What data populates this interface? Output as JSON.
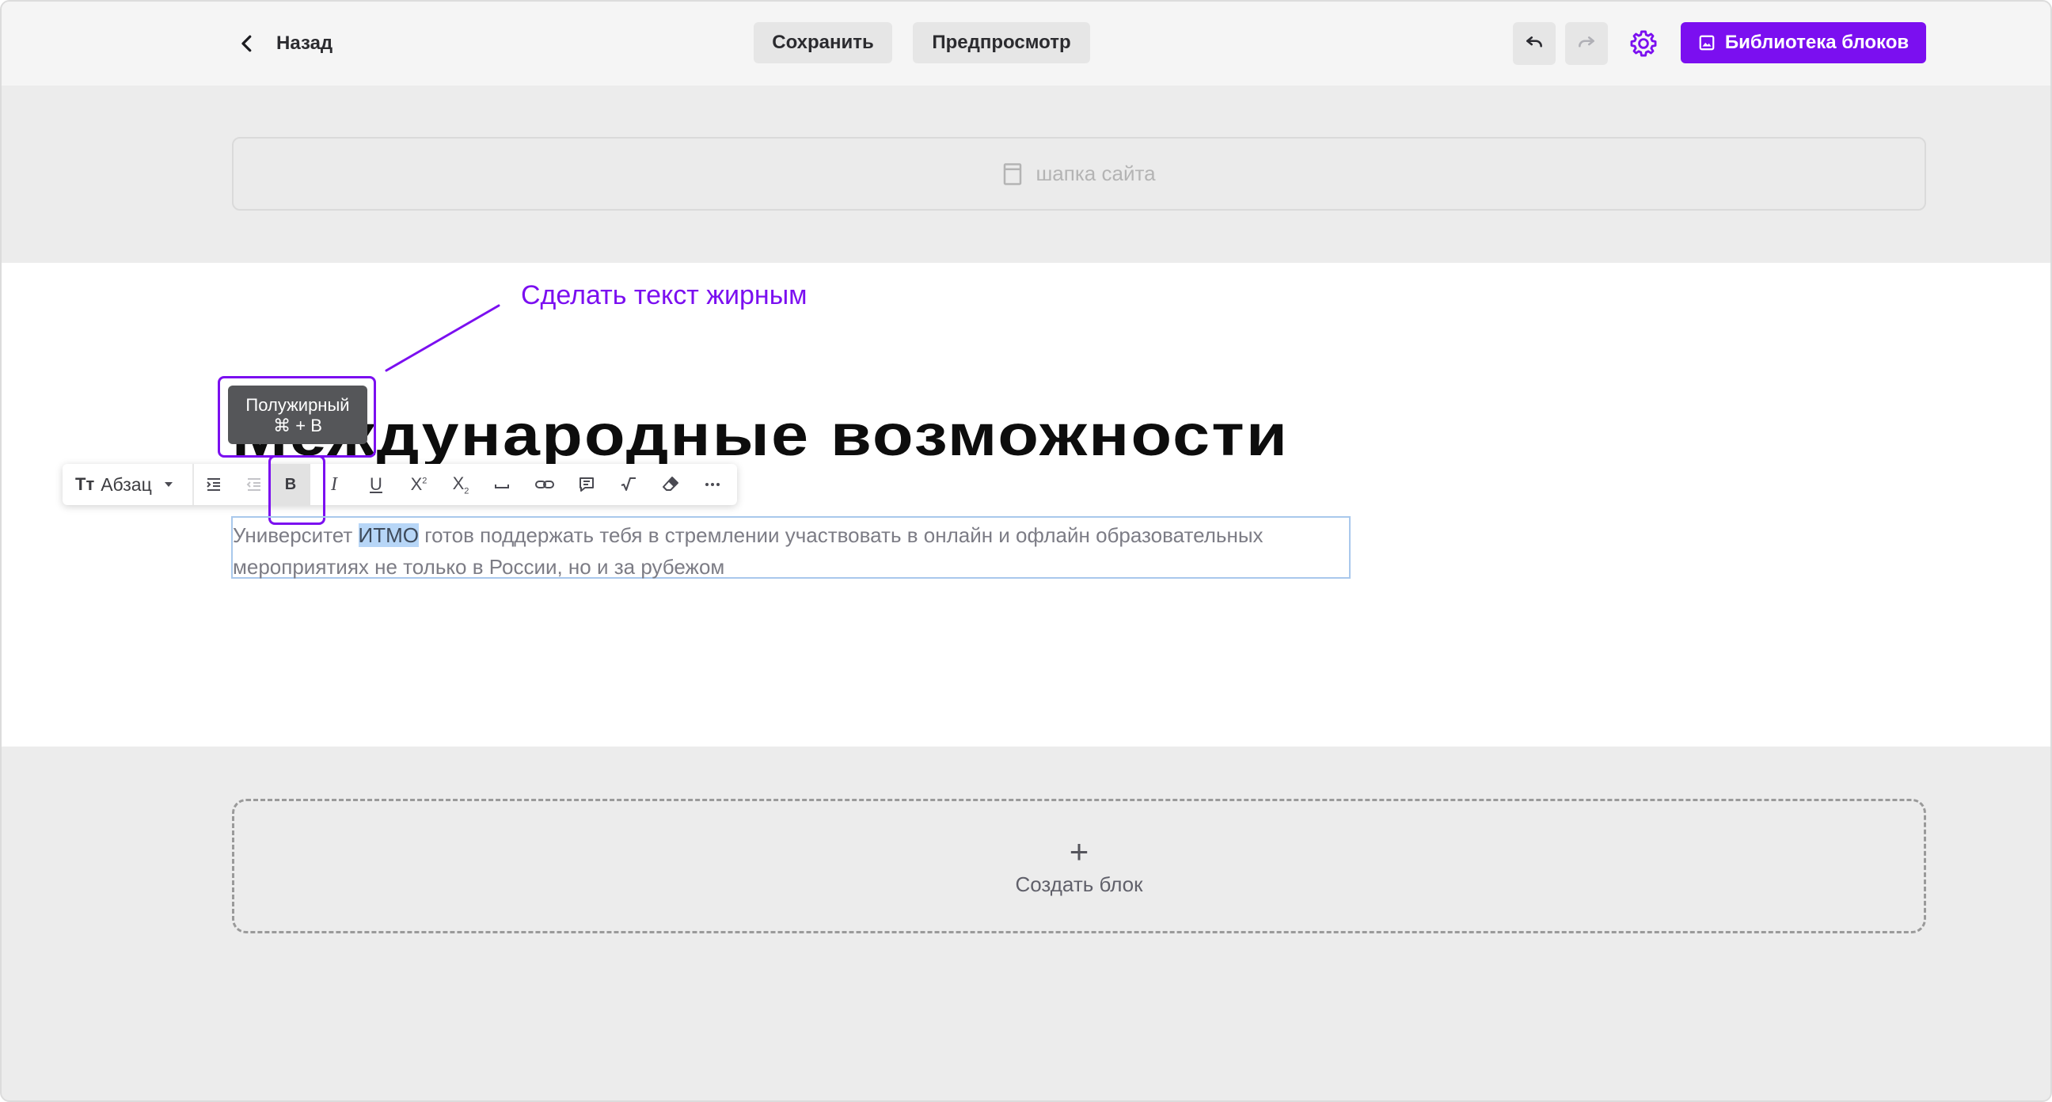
{
  "topbar": {
    "back_label": "Назад",
    "save_label": "Сохранить",
    "preview_label": "Предпросмотр",
    "library_label": "Библиотека блоков"
  },
  "header_placeholder": {
    "label": "шапка сайта"
  },
  "annotation": {
    "text": "Сделать текст жирным"
  },
  "tooltip": {
    "title": "Полужирный",
    "shortcut": "⌘ + B"
  },
  "heading": {
    "text": "Международные возможности"
  },
  "toolbar": {
    "style_icon": "Tт",
    "style_label": "Абзац",
    "buttons": [
      "indent",
      "outdent",
      "bold",
      "italic",
      "underline",
      "superscript",
      "subscript",
      "non-breaking-space",
      "link",
      "comment",
      "formula",
      "clear-format",
      "more"
    ]
  },
  "paragraph": {
    "before": "Университет ",
    "selected": "ИТМО",
    "after": " готов поддержать тебя в стремлении участвовать в онлайн и офлайн образовательных мероприятиях не только в России, но и за рубежом"
  },
  "create_block": {
    "plus": "+",
    "label": "Создать блок"
  },
  "colors": {
    "accent": "#7b0ff0",
    "selection": "#b7d6f7",
    "focus_border": "#a9c8ec"
  }
}
